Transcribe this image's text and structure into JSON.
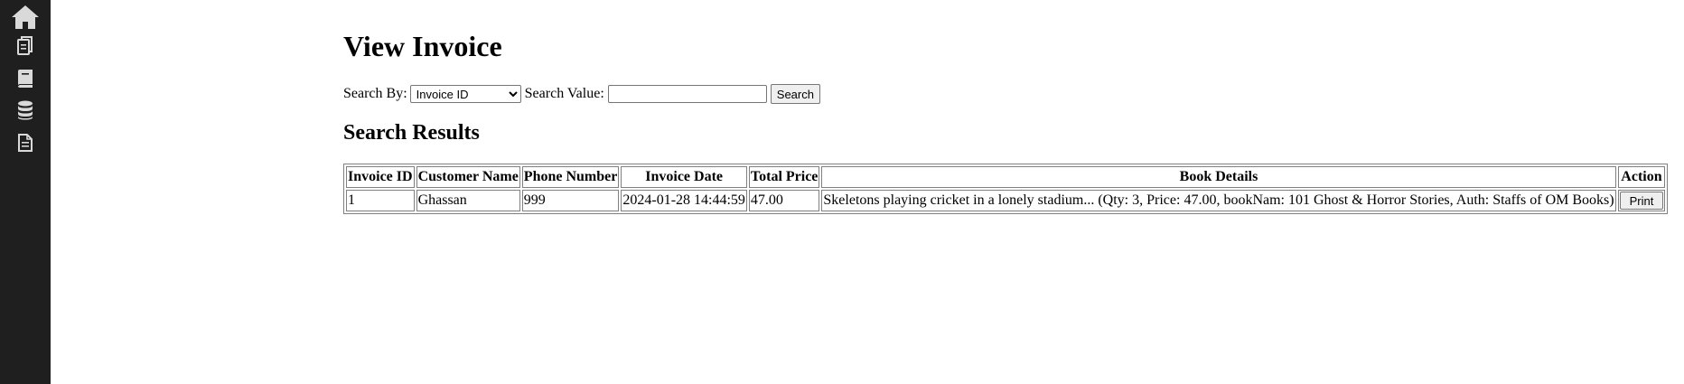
{
  "sidebar": {
    "icons": [
      {
        "name": "home-icon"
      },
      {
        "name": "copy-document-icon"
      },
      {
        "name": "book-icon"
      },
      {
        "name": "database-icon"
      },
      {
        "name": "document-icon"
      }
    ],
    "background": "#1f1f1f",
    "icon_color": "#d9d9d9"
  },
  "page": {
    "title": "View Invoice"
  },
  "search": {
    "by_label": "Search By:",
    "by_selected": "Invoice ID",
    "value_label": "Search Value:",
    "value": "",
    "button_label": "Search"
  },
  "results": {
    "title": "Search Results",
    "columns": [
      "Invoice ID",
      "Customer Name",
      "Phone Number",
      "Invoice Date",
      "Total Price",
      "Book Details",
      "Action"
    ],
    "rows": [
      {
        "invoice_id": "1",
        "customer_name": "Ghassan",
        "phone_number": "999",
        "invoice_date": "2024-01-28 14:44:59",
        "total_price": "47.00",
        "book_details": "Skeletons playing cricket in a lonely stadium... (Qty: 3, Price: 47.00, bookNam: 101 Ghost & Horror Stories, Auth: Staffs of OM Books)",
        "action_label": "Print"
      }
    ]
  }
}
